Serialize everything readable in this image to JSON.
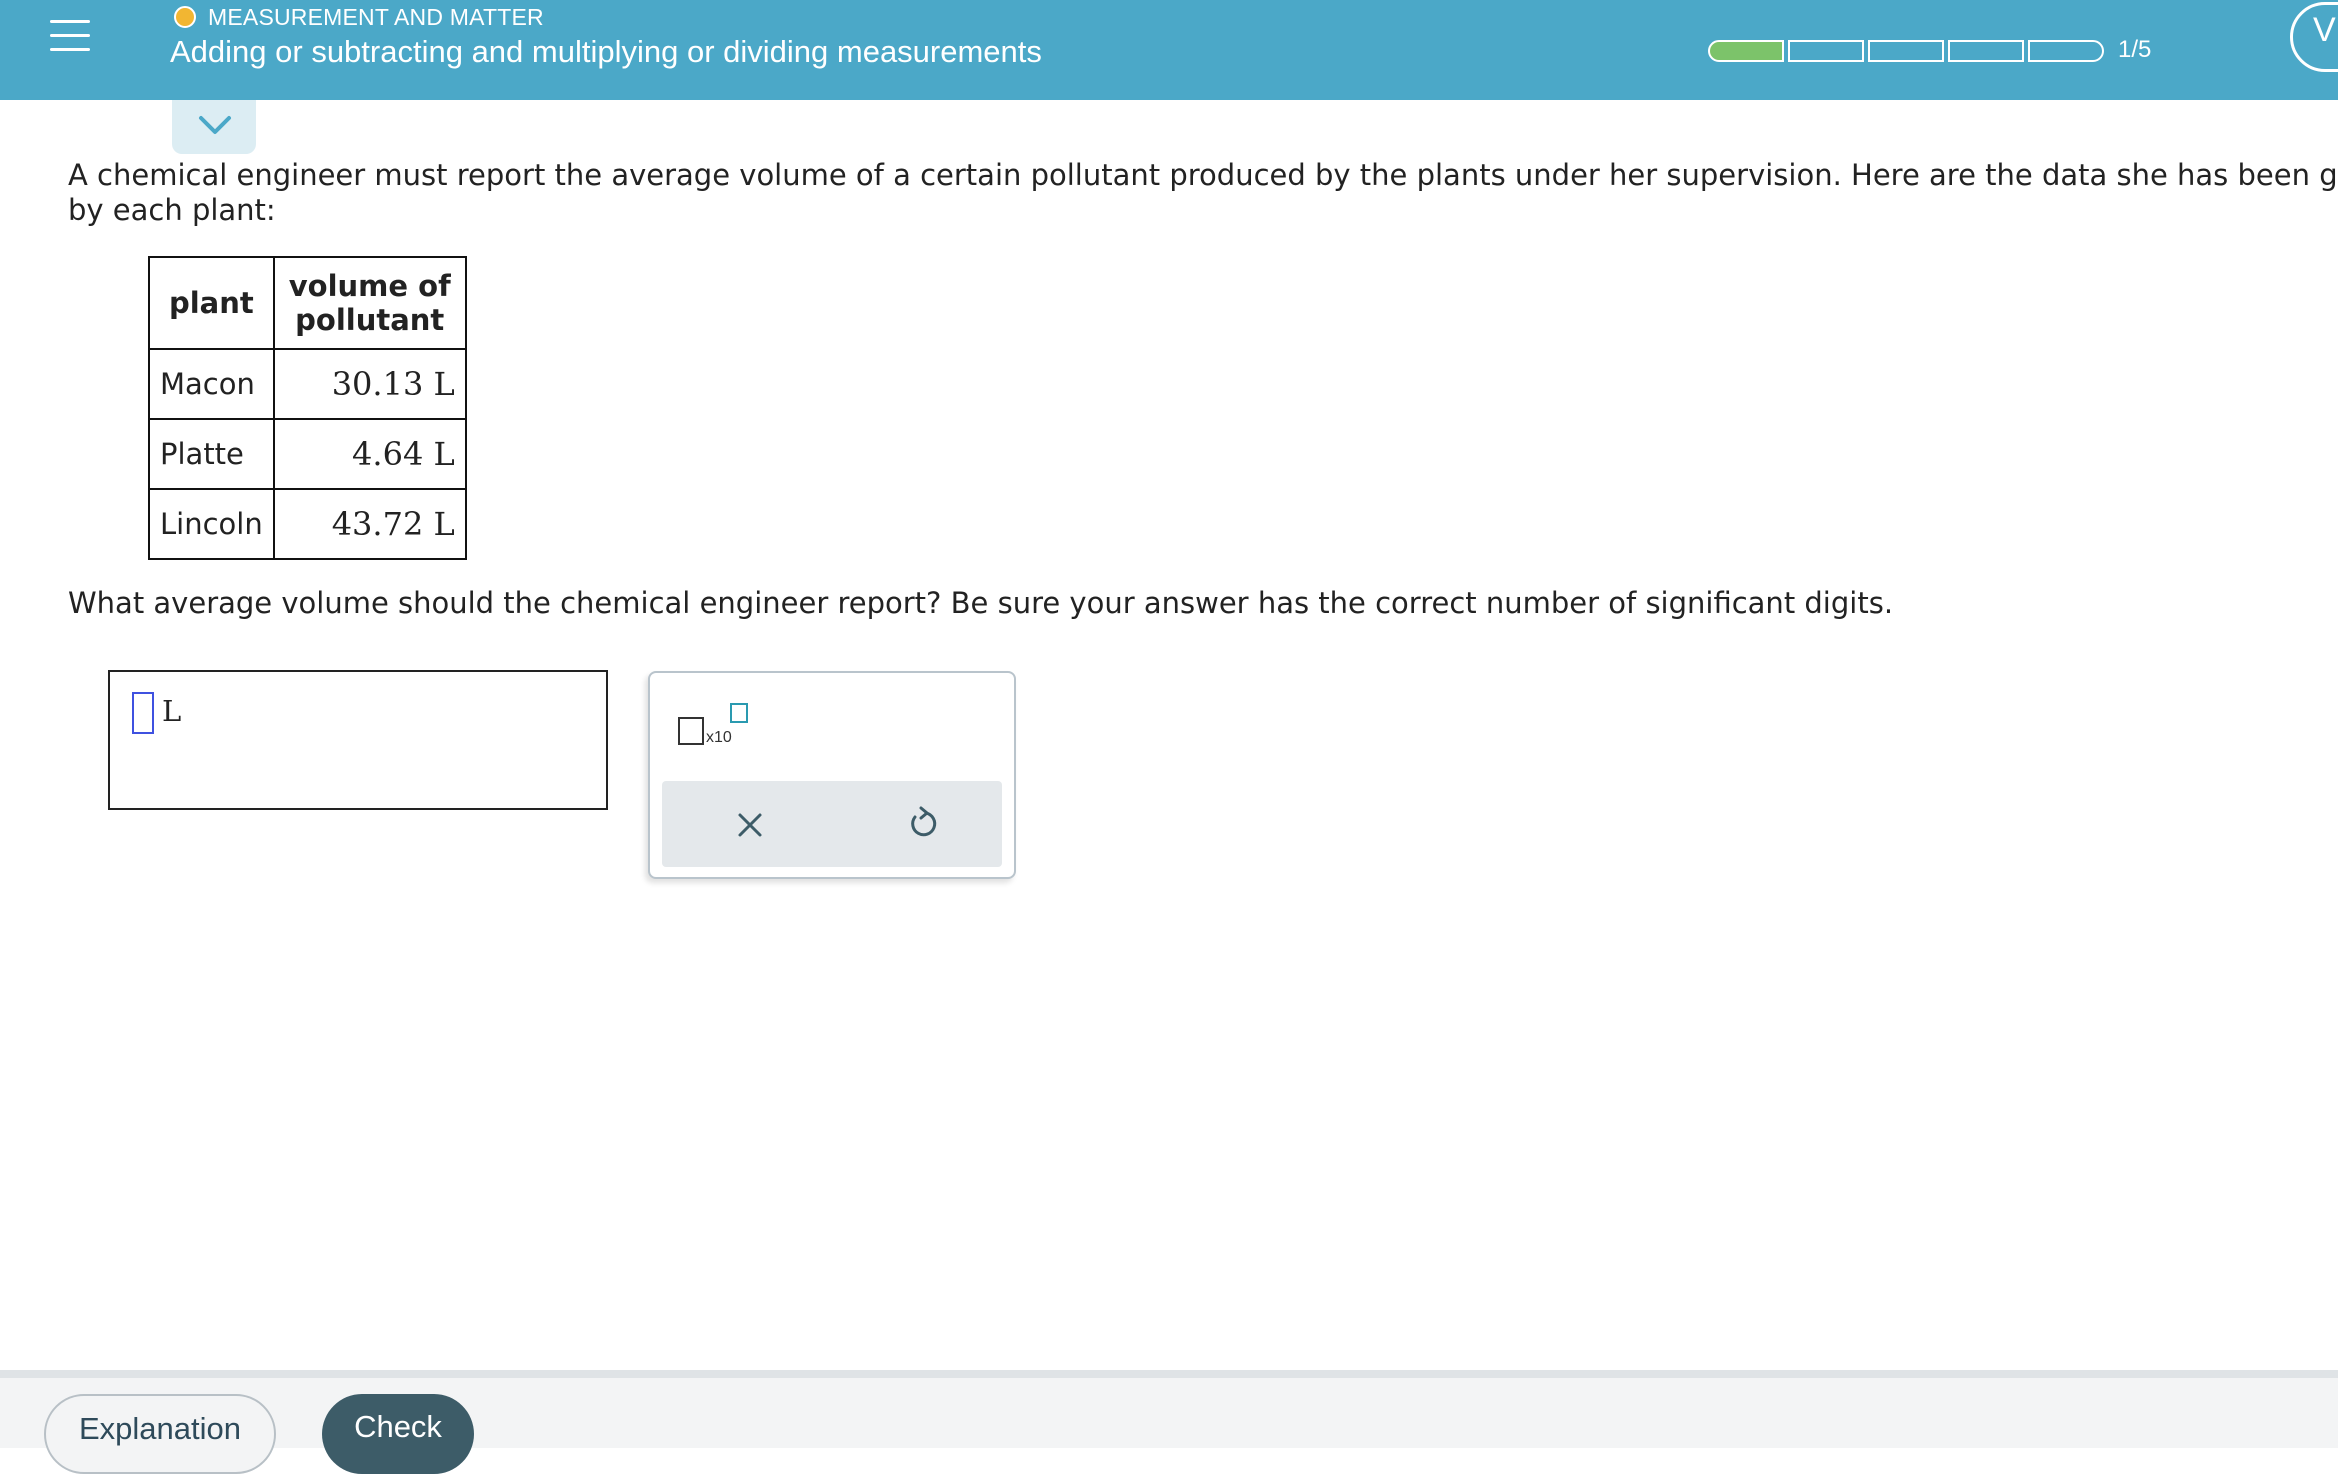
{
  "header": {
    "topic": "MEASUREMENT AND MATTER",
    "title": "Adding or subtracting and multiplying or dividing measurements",
    "progress": {
      "completed": 1,
      "total": 5,
      "label": "1/5"
    },
    "side_button_letter": "V",
    "colors": {
      "bar": "#4ba8c8",
      "status_dot": "#f2b632",
      "progress_done": "#7cc36a"
    }
  },
  "question": {
    "line1": "A chemical engineer must report the average volume of a certain pollutant produced by the plants under her supervision. Here are the data she has been given",
    "line2": "by each plant:",
    "table": {
      "headers": [
        "plant",
        "volume of pollutant"
      ],
      "rows": [
        {
          "plant": "Macon",
          "volume": "30.13 L"
        },
        {
          "plant": "Platte",
          "volume": "4.64 L"
        },
        {
          "plant": "Lincoln",
          "volume": "43.72 L"
        }
      ]
    },
    "prompt": "What average volume should the chemical engineer report? Be sure your answer has the correct number of significant digits."
  },
  "answer": {
    "value": "",
    "unit": "L"
  },
  "keypad": {
    "sci_notation_label": "x10",
    "clear_icon": "close-icon",
    "undo_icon": "undo-icon"
  },
  "footer": {
    "explanation_label": "Explanation",
    "check_label": "Check"
  }
}
